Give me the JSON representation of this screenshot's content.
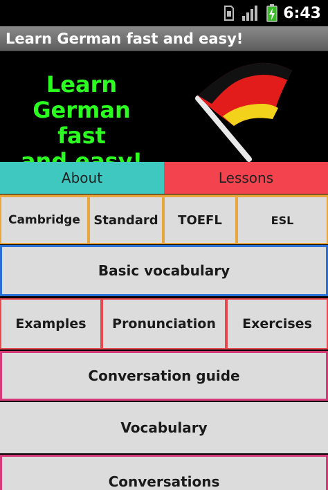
{
  "status": {
    "time": "6:43",
    "icons": [
      "sim-icon",
      "signal-icon",
      "battery-icon"
    ]
  },
  "app": {
    "title": "Learn German fast and easy!"
  },
  "banner": {
    "lines": [
      "Learn",
      "German fast",
      "and easy!"
    ],
    "text_color": "#2bff1f"
  },
  "tabs": {
    "about": "About",
    "lessons": "Lessons"
  },
  "exams": [
    "Cambridge",
    "Standard",
    "TOEFL",
    "ESL"
  ],
  "buttons": {
    "basic_vocabulary": "Basic vocabulary",
    "examples": "Examples",
    "pronunciation": "Pronunciation",
    "exercises": "Exercises",
    "conversation_guide": "Conversation guide",
    "vocabulary": "Vocabulary",
    "conversations": "Conversations"
  },
  "colors": {
    "about_tab": "#3ec8c0",
    "lessons_tab": "#f2434f",
    "exam_border": "#e8a63c",
    "blue_border": "#2a6fd6",
    "red_border": "#e8474f",
    "pink_border": "#d43a78"
  }
}
